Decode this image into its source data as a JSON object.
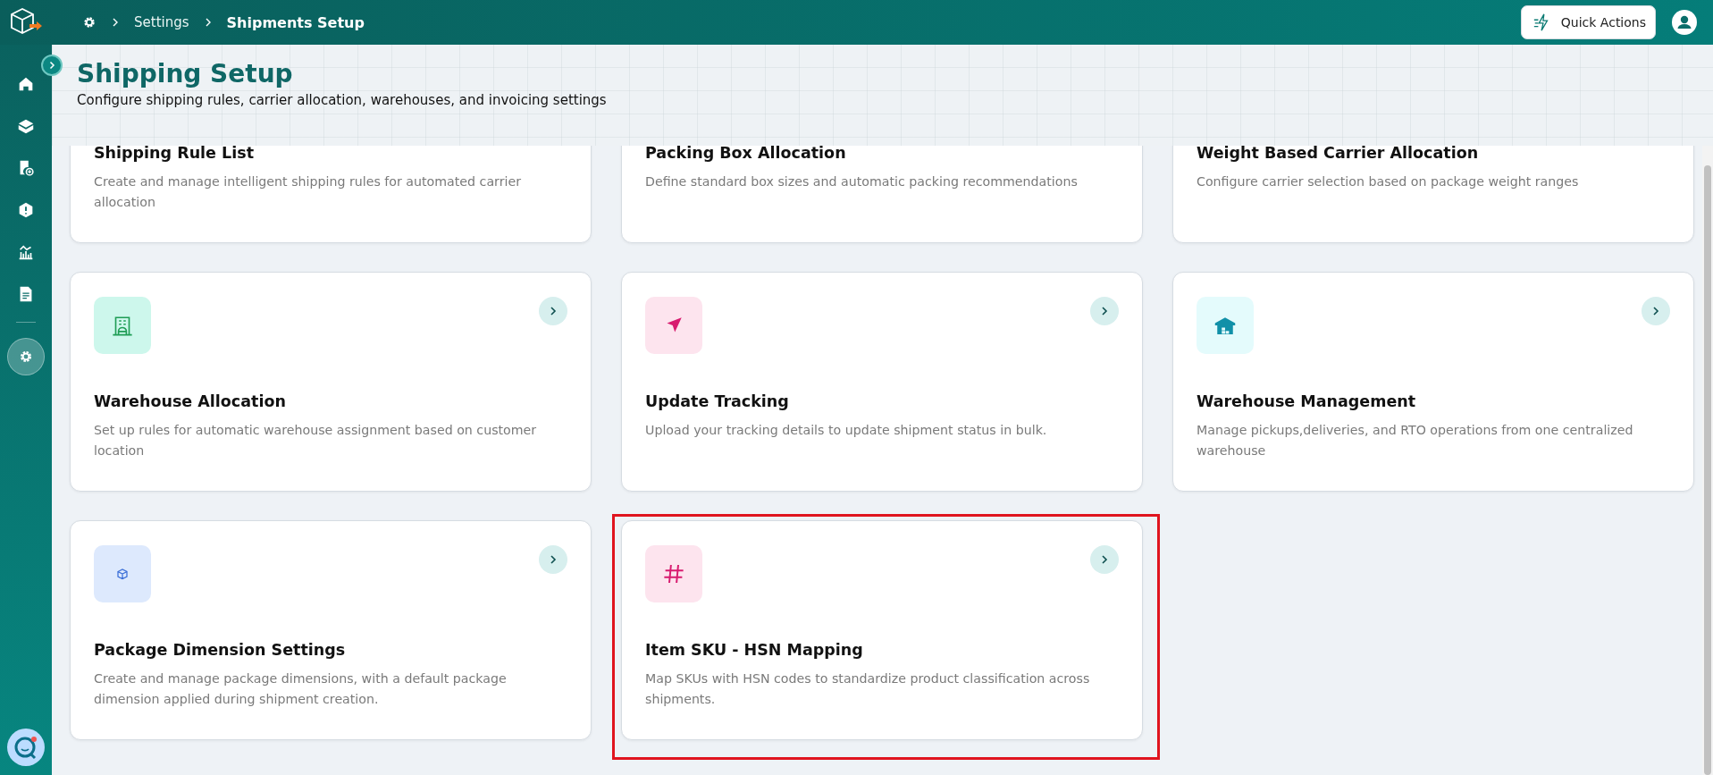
{
  "breadcrumb": {
    "items": [
      {
        "label": "Settings",
        "current": false
      },
      {
        "label": "Shipments Setup",
        "current": true
      }
    ]
  },
  "quick_actions": {
    "label": "Quick Actions"
  },
  "sidebar": {
    "items": [
      {
        "selected": false
      },
      {
        "selected": false
      },
      {
        "selected": false
      },
      {
        "selected": false
      },
      {
        "selected": false
      },
      {
        "selected": false
      },
      {
        "selected": true
      }
    ]
  },
  "page": {
    "title": "Shipping Setup",
    "subtitle": "Configure shipping rules, carrier allocation, warehouses, and invoicing settings"
  },
  "cards": [
    {
      "title": "Shipping Rule List",
      "description": "Create and manage intelligent shipping rules for automated carrier allocation",
      "highlighted": false
    },
    {
      "title": "Packing Box Allocation",
      "description": "Define standard box sizes and automatic packing recommendations",
      "highlighted": false
    },
    {
      "title": "Weight Based Carrier Allocation",
      "description": "Configure carrier selection based on package weight ranges",
      "highlighted": false
    },
    {
      "title": "Warehouse Allocation",
      "description": "Set up rules for automatic warehouse assignment based on customer location",
      "highlighted": false
    },
    {
      "title": "Update Tracking",
      "description": "Upload your tracking details to update shipment status in bulk.",
      "highlighted": false
    },
    {
      "title": "Warehouse Management",
      "description": "Manage pickups,deliveries, and RTO operations from one centralized warehouse",
      "highlighted": false
    },
    {
      "title": "Package Dimension Settings",
      "description": "Create and manage package dimensions, with a default package dimension applied during shipment creation.",
      "highlighted": false
    },
    {
      "title": "Item SKU - HSN Mapping",
      "description": "Map SKUs with HSN codes to standardize product classification across shipments.",
      "highlighted": true
    }
  ]
}
